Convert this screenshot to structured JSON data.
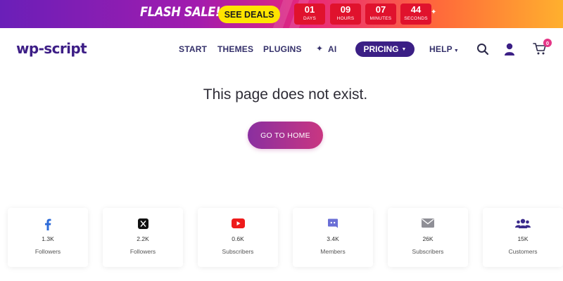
{
  "banner": {
    "title": "FLASH SALE!",
    "cta_label": "SEE DEALS",
    "countdown": [
      {
        "value": "01",
        "unit": "DAYS"
      },
      {
        "value": "09",
        "unit": "HOURS"
      },
      {
        "value": "07",
        "unit": "MINUTES"
      },
      {
        "value": "44",
        "unit": "SECONDS"
      }
    ]
  },
  "header": {
    "logo": "wp-script",
    "nav": {
      "start": "START",
      "themes": "THEMES",
      "plugins": "PLUGINS",
      "ai": "AI",
      "pricing": "PRICING",
      "help": "HELP"
    },
    "cart_count": "0"
  },
  "main": {
    "message": "This page does not exist.",
    "button_label": "GO TO HOME"
  },
  "social": [
    {
      "icon": "facebook-icon",
      "count": "1.3K",
      "label": "Followers"
    },
    {
      "icon": "x-icon",
      "count": "2.2K",
      "label": "Followers"
    },
    {
      "icon": "youtube-icon",
      "count": "0.6K",
      "label": "Subscribers"
    },
    {
      "icon": "discord-icon",
      "count": "3.4K",
      "label": "Members"
    },
    {
      "icon": "envelope-icon",
      "count": "26K",
      "label": "Subscribers"
    },
    {
      "icon": "users-icon",
      "count": "15K",
      "label": "Customers"
    }
  ],
  "colors": {
    "brand": "#3b1f85",
    "countdown_red": "#e0122d",
    "cta_yellow": "#ffe400",
    "accent_pink": "#e43586"
  }
}
